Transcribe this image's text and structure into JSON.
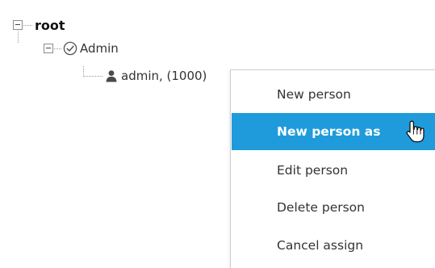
{
  "tree": {
    "root": {
      "label": "root",
      "icon": "collapse-toggle-icon"
    },
    "group": {
      "label": "Admin",
      "icon": "check-circle-icon"
    },
    "person": {
      "label": "admin, (1000)",
      "icon": "person-icon"
    }
  },
  "context_menu": {
    "items": [
      {
        "label": "New person",
        "state": "normal"
      },
      {
        "label": "New person as",
        "state": "highlighted"
      },
      {
        "label": "Edit person",
        "state": "normal"
      },
      {
        "label": "Delete person",
        "state": "normal"
      },
      {
        "label": "Cancel assign",
        "state": "normal"
      }
    ]
  },
  "colors": {
    "highlight": "#1f9bdb",
    "text": "#333333",
    "tree_lines": "#999999"
  }
}
